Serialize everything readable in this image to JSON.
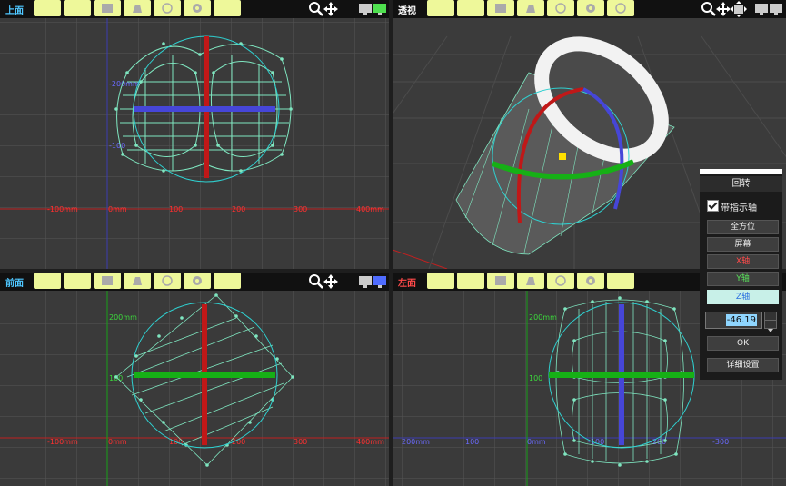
{
  "viewports": {
    "top": {
      "label": "上面",
      "label_color": "#4fc7ff",
      "axis_labels": {
        "y1": "-200mm",
        "y2": "-100",
        "x0": "-100mm",
        "x1": "0mm",
        "x2": "100",
        "x3": "200",
        "x4": "300",
        "x5": "400mm"
      }
    },
    "perspective": {
      "label": "透视",
      "label_color": "#ffffff"
    },
    "front": {
      "label": "前面",
      "label_color": "#4fc7ff",
      "axis_labels": {
        "y1": "200mm",
        "y2": "100",
        "x0": "-100mm",
        "x1": "0mm",
        "x2": "100",
        "x3": "200",
        "x4": "300",
        "x5": "400mm"
      }
    },
    "left": {
      "label": "左面",
      "label_color": "#ff4a4a",
      "axis_labels": {
        "y1": "200mm",
        "y2": "100",
        "x0": "200mm",
        "x1": "100",
        "x2": "0mm",
        "x3": "-100",
        "x4": "-200",
        "x5": "-300"
      }
    }
  },
  "icons": {
    "zoom": "magnifier-icon",
    "move": "move-arrows-icon",
    "screens": "dual-monitor-icon"
  },
  "panel": {
    "title": "回转",
    "show_axis_label": "带指示轴",
    "show_axis_checked": true,
    "buttons": {
      "all_direction": "全方位",
      "screen": "屏幕",
      "x_axis": "X轴",
      "y_axis": "Y轴",
      "z_axis": "Z轴",
      "ok": "OK",
      "details": "详细设置"
    },
    "angle_value": "-46.19",
    "colors": {
      "x": "#ff4a4a",
      "y": "#58e05a",
      "z": "#5aa0ff",
      "selected_bg": "#c8f0e8"
    }
  }
}
